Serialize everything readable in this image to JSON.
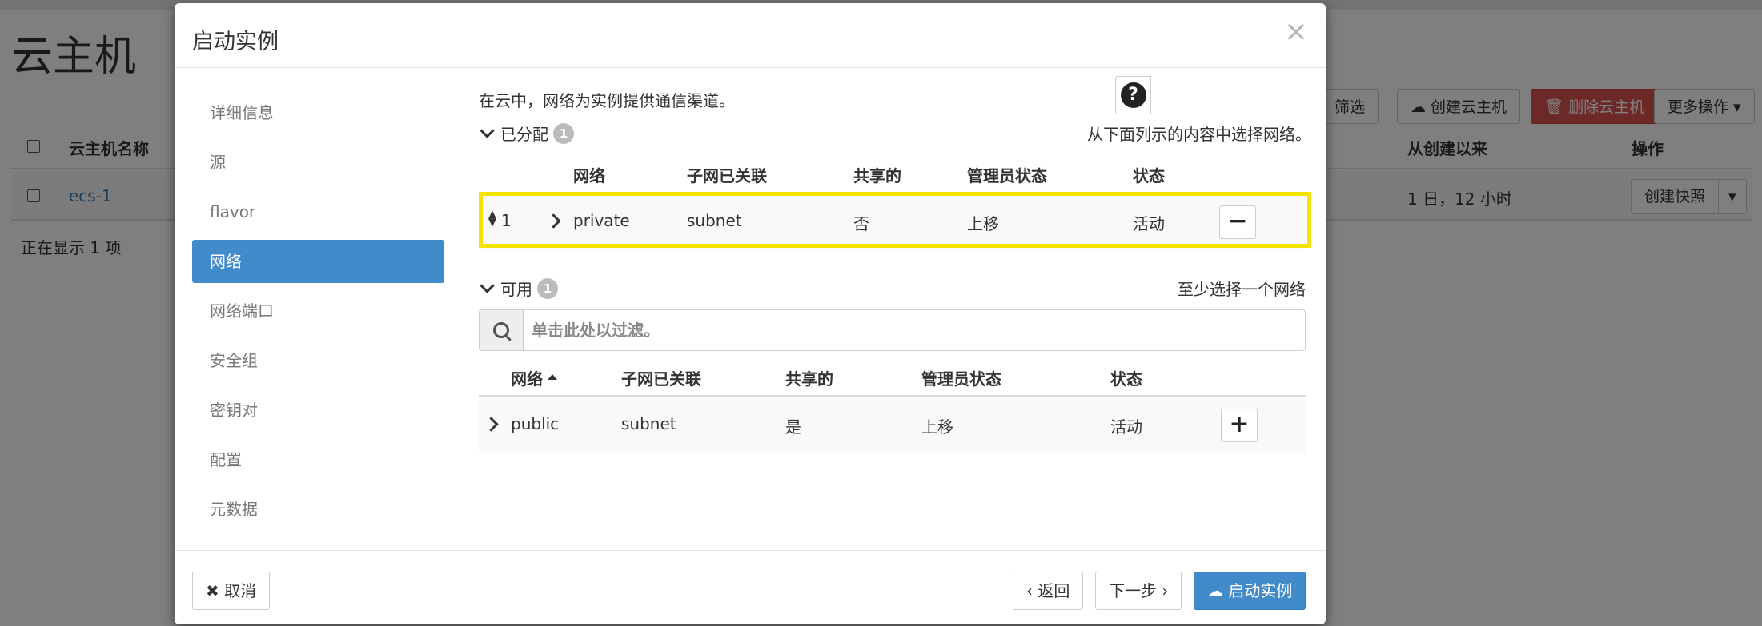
{
  "page": {
    "title": "云主机",
    "toolbar": {
      "filter": "筛选",
      "create": "创建云主机",
      "delete": "删除云主机",
      "more": "更多操作"
    },
    "table": {
      "headers": {
        "name": "云主机名称",
        "age": "从创建以来",
        "actions": "操作"
      },
      "row": {
        "name": "ecs-1",
        "age": "1 日，12 小时",
        "action": "创建快照"
      },
      "count": "正在显示 1 项"
    }
  },
  "modal": {
    "title": "启动实例",
    "close": "×",
    "help": "?",
    "nav": [
      "详细信息",
      "源",
      "flavor",
      "网络",
      "网络端口",
      "安全组",
      "密钥对",
      "配置",
      "元数据"
    ],
    "active_nav": "网络",
    "intro": "在云中，网络为实例提供通信渠道。",
    "allocated": {
      "title": "已分配",
      "count": "1",
      "hint": "从下面列示的内容中选择网络。",
      "headers": {
        "network": "网络",
        "subnet": "子网已关联",
        "shared": "共享的",
        "admin": "管理员状态",
        "status": "状态"
      },
      "rows": [
        {
          "order": "1",
          "network": "private",
          "subnet": "subnet",
          "shared": "否",
          "admin": "上移",
          "status": "活动",
          "action": "−"
        }
      ]
    },
    "available": {
      "title": "可用",
      "count": "1",
      "hint": "至少选择一个网络",
      "filter_placeholder": "单击此处以过滤。",
      "headers": {
        "network": "网络",
        "subnet": "子网已关联",
        "shared": "共享的",
        "admin": "管理员状态",
        "status": "状态"
      },
      "rows": [
        {
          "network": "public",
          "subnet": "subnet",
          "shared": "是",
          "admin": "上移",
          "status": "活动",
          "action": "+"
        }
      ]
    },
    "footer": {
      "cancel": "取消",
      "back": "返回",
      "next": "下一步",
      "launch": "启动实例"
    }
  },
  "colors": {
    "primary": "#428bca",
    "danger": "#d9534f",
    "highlight": "#f5e400"
  },
  "icons": {
    "close": "close-icon",
    "help": "question-circle-icon",
    "search": "search-icon",
    "cloud_upload": "cloud-upload-icon",
    "trash": "trash-icon"
  }
}
